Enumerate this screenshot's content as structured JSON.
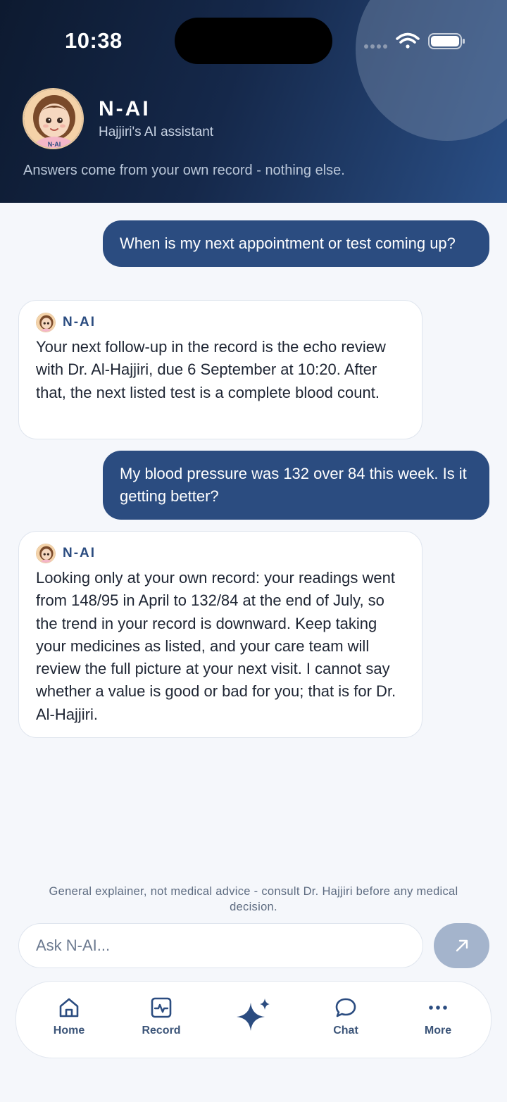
{
  "status_bar": {
    "time": "10:38"
  },
  "header": {
    "title": "N-AI",
    "subtitle": "Hajjiri's AI assistant",
    "note": "Answers come from your own record - nothing else.",
    "avatar_caption": "N-AI"
  },
  "messages": [
    {
      "role": "user",
      "text": "When is my next appointment or test coming up?"
    },
    {
      "role": "assistant",
      "name": "N-AI",
      "text": "Your next follow-up in the record is the echo review with Dr. Al-Hajjiri, due 6 September at 10:20. After that, the next listed test is a complete blood count."
    },
    {
      "role": "user",
      "text": "My blood pressure was 132 over 84 this week. Is it getting better?"
    },
    {
      "role": "assistant",
      "name": "N-AI",
      "text": "Looking only at your own record: your readings went from 148/95 in April to 132/84 at the end of July, so the trend in your record is downward. Keep taking your medicines as listed, and your care team will review the full picture at your next visit. I cannot say whether a value is good or bad for you; that is for Dr. Al-Hajjiri."
    }
  ],
  "disclaimer": "General explainer, not medical advice - consult Dr. Hajjiri before any medical decision.",
  "composer": {
    "placeholder": "Ask N-AI..."
  },
  "tabbar": {
    "home": "Home",
    "record": "Record",
    "chat": "Chat",
    "more": "More"
  },
  "colors": {
    "accent": "#2b4c80",
    "header_dark": "#0d1a30",
    "send_disabled": "#a4b4cc",
    "background": "#f5f7fb"
  },
  "icons": [
    "wifi-icon",
    "battery-icon",
    "signal-icon",
    "send-arrow-icon",
    "home-icon",
    "record-icon",
    "sparkle-icon",
    "chat-icon",
    "more-icon"
  ]
}
